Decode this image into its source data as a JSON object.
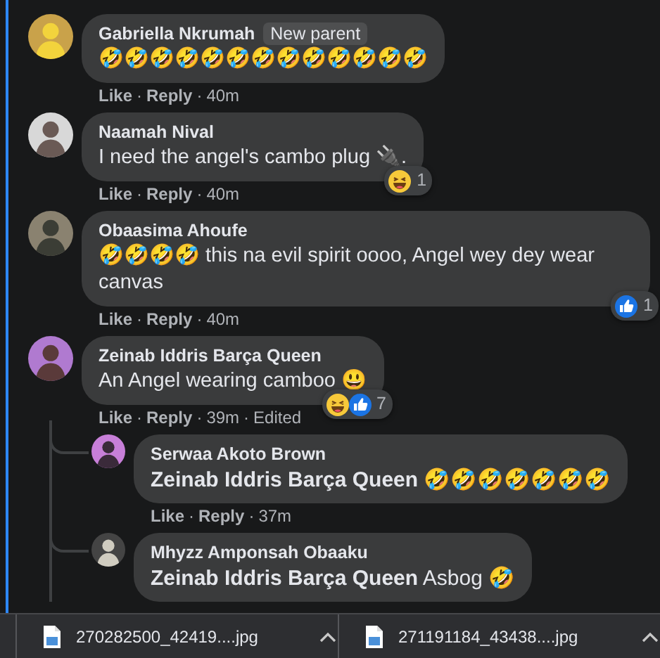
{
  "comments": [
    {
      "author": "Gabriella Nkrumah",
      "badge": "New parent",
      "text": "🤣🤣🤣🤣🤣🤣🤣🤣🤣🤣🤣🤣🤣",
      "actions": [
        "Like",
        "Reply"
      ],
      "time": "40m",
      "separator": "·"
    },
    {
      "author": "Naamah Nival",
      "text": "I need the angel's cambo plug 🔌.",
      "actions": [
        "Like",
        "Reply"
      ],
      "time": "40m",
      "separator": "·",
      "reactions": [
        {
          "kind": "haha"
        }
      ],
      "reaction_count": "1"
    },
    {
      "author": "Obaasima Ahoufe",
      "text": "🤣🤣🤣🤣 this na evil spirit oooo, Angel wey dey wear canvas",
      "actions": [
        "Like",
        "Reply"
      ],
      "time": "40m",
      "separator": "·",
      "reactions": [
        {
          "kind": "like"
        }
      ],
      "reaction_count": "1"
    },
    {
      "author": "Zeinab Iddris Barça Queen",
      "text": "An Angel wearing camboo 😃",
      "actions": [
        "Like",
        "Reply"
      ],
      "time": "39m",
      "edited": "Edited",
      "separator": "·",
      "reactions": [
        {
          "kind": "haha"
        },
        {
          "kind": "like"
        }
      ],
      "reaction_count": "7",
      "replies": [
        {
          "author": "Serwaa Akoto Brown",
          "text": "**Zeinab Iddris Barça Queen** 🤣🤣🤣🤣🤣🤣🤣",
          "actions": [
            "Like",
            "Reply"
          ],
          "time": "37m",
          "separator": "·"
        },
        {
          "author": "Mhyzz Amponsah Obaaku",
          "text": "**Zeinab Iddris Barça Queen** Asbog 🤣"
        }
      ]
    }
  ],
  "downloads": [
    {
      "filename": "270282500_42419....jpg"
    },
    {
      "filename": "271191184_43438....jpg"
    }
  ]
}
